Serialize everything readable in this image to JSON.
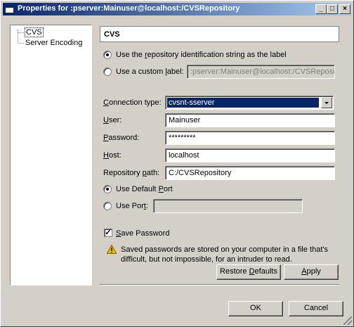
{
  "window": {
    "title": "Properties for :pserver:Mainuser@localhost:/CVSRepository",
    "min_label": "_",
    "max_label": "□",
    "close_label": "×"
  },
  "tree": {
    "items": [
      {
        "label": "CVS",
        "selected": true
      },
      {
        "label": "Server Encoding",
        "selected": false
      }
    ]
  },
  "page": {
    "title": "CVS"
  },
  "label_options": {
    "repo_id": {
      "pre": "Use the ",
      "key": "r",
      "post": "epository identification string as the label",
      "checked": true
    },
    "custom": {
      "pre": "Use a custom ",
      "key": "l",
      "post": "abel:",
      "checked": false
    },
    "custom_value": ":pserver:Mainuser@localhost:/CVSReposito"
  },
  "connection": {
    "type_label_pre": "",
    "type_label_key": "C",
    "type_label_post": "onnection type:",
    "type_value": "cvsnt-sserver",
    "user_label_key": "U",
    "user_label_post": "ser:",
    "user_value": "Mainuser",
    "password_label_key": "P",
    "password_label_post": "assword:",
    "password_value": "*********",
    "host_label_key": "H",
    "host_label_post": "ost:",
    "host_value": "localhost",
    "repo_label_pre": "Repository ",
    "repo_label_key": "p",
    "repo_label_post": "ath:",
    "repo_value": "C:/CVSRepository"
  },
  "port": {
    "default": {
      "pre": "Use Default ",
      "key": "P",
      "post": "ort",
      "checked": true
    },
    "custom": {
      "pre": "Use Por",
      "key": "t",
      "post": ":",
      "checked": false
    },
    "custom_value": ""
  },
  "save_password": {
    "key": "S",
    "post": "ave Password",
    "checked": true,
    "check_mark": "✓",
    "note": "Saved passwords are stored on your computer in a file that's difficult, but not impossible, for an intruder to read."
  },
  "buttons": {
    "restore_pre": "Restore ",
    "restore_key": "D",
    "restore_post": "efaults",
    "apply_key": "A",
    "apply_post": "pply",
    "ok": "OK",
    "cancel": "Cancel"
  },
  "colors": {
    "title_active": "#0a246a",
    "face": "#d4d0c8",
    "selection": "#0a246a",
    "warning": "#f0c000"
  }
}
